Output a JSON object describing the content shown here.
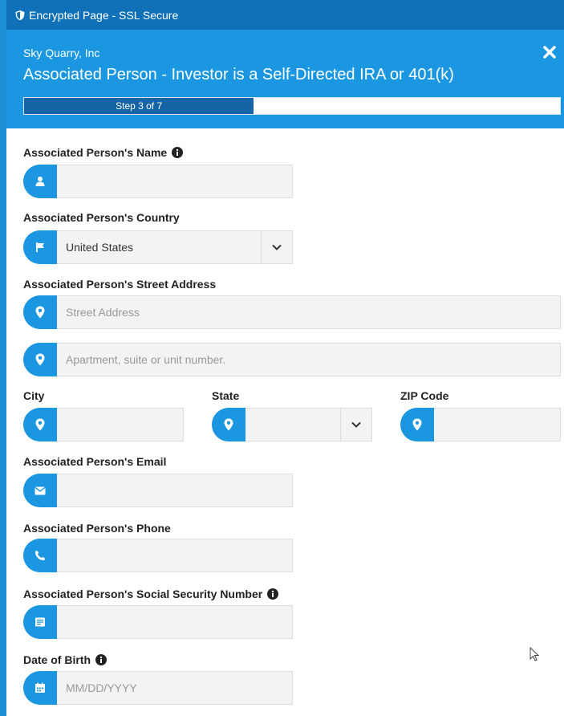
{
  "secure_bar": {
    "label": "Encrypted Page - SSL Secure"
  },
  "header": {
    "company": "Sky Quarry, Inc",
    "title": "Associated Person - Investor is a Self-Directed IRA or 401(k)",
    "progress": {
      "label": "Step 3 of 7",
      "current": 3,
      "total": 7
    }
  },
  "form": {
    "name": {
      "label": "Associated Person's Name",
      "value": ""
    },
    "country": {
      "label": "Associated Person's Country",
      "value": "United States"
    },
    "street": {
      "label": "Associated Person's Street Address",
      "line1_placeholder": "Street Address",
      "line2_placeholder": "Apartment, suite or unit number."
    },
    "city": {
      "label": "City",
      "value": ""
    },
    "state": {
      "label": "State",
      "value": ""
    },
    "zip": {
      "label": "ZIP Code",
      "value": ""
    },
    "email": {
      "label": "Associated Person's Email",
      "value": ""
    },
    "phone": {
      "label": "Associated Person's Phone",
      "value": ""
    },
    "ssn": {
      "label": "Associated Person's Social Security Number",
      "value": ""
    },
    "dob": {
      "label": "Date of Birth",
      "placeholder": "MM/DD/YYYY"
    }
  },
  "colors": {
    "header": "#1a97e0",
    "secure_bar": "#1171b8",
    "progress_fill": "#1564a6",
    "icon_bg": "#1a97e0"
  }
}
